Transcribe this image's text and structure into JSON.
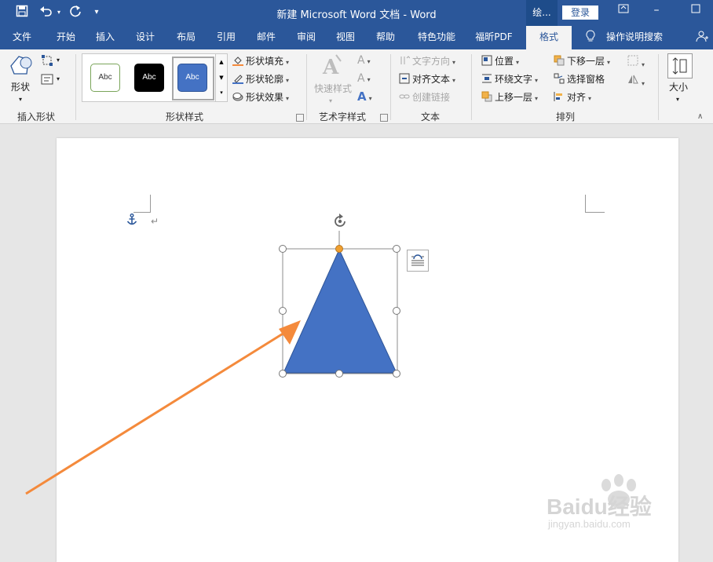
{
  "window": {
    "title": "新建 Microsoft Word 文档 - Word",
    "account_short": "绘...",
    "login_label": "登录"
  },
  "quick_access": {
    "save_icon": "save-icon",
    "undo_icon": "undo-icon",
    "redo_icon": "redo-icon",
    "customize_icon": "customize-qa-icon"
  },
  "tabs": [
    "文件",
    "开始",
    "插入",
    "设计",
    "布局",
    "引用",
    "邮件",
    "审阅",
    "视图",
    "帮助",
    "特色功能",
    "福昕PDF",
    "格式"
  ],
  "active_tab": "格式",
  "tell_me": "操作说明搜索",
  "ribbon": {
    "insert_shapes": {
      "shapes_label": "形状",
      "group_label": "插入形状"
    },
    "shape_styles": {
      "swatch_text": "Abc",
      "fill_label": "形状填充",
      "outline_label": "形状轮廓",
      "effects_label": "形状效果",
      "group_label": "形状样式"
    },
    "wordart": {
      "quick_styles_label": "快速样式",
      "group_label": "艺术字样式"
    },
    "text": {
      "direction_label": "文字方向",
      "align_label": "对齐文本",
      "link_label": "创建链接",
      "group_label": "文本"
    },
    "arrange": {
      "position_label": "位置",
      "wrap_label": "环绕文字",
      "forward_label": "上移一层",
      "backward_label": "下移一层",
      "pane_label": "选择窗格",
      "align_label": "对齐",
      "group_label": "排列"
    },
    "size": {
      "label": "大小"
    }
  },
  "colors": {
    "brand": "#2b579a",
    "shape_fill": "#4472c4",
    "arrow": "#f48a3c",
    "accent_handle": "#f0a030"
  },
  "watermark": {
    "brand": "Baidu经验",
    "url": "jingyan.baidu.com"
  }
}
